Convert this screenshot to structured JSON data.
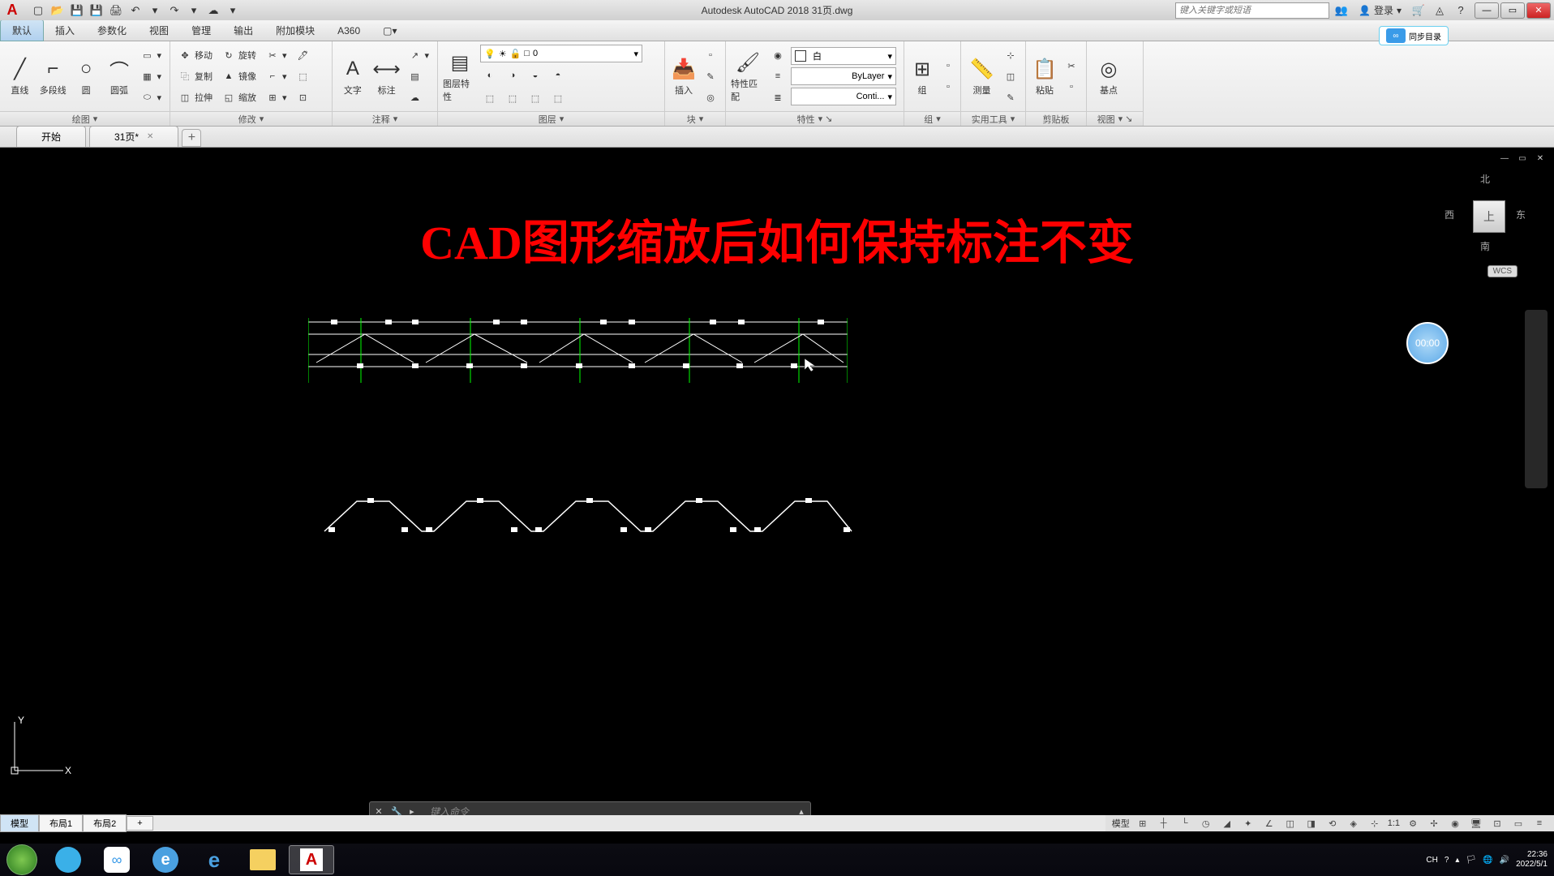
{
  "titlebar": {
    "app_title": "Autodesk AutoCAD 2018    31页.dwg",
    "search_placeholder": "键入关键字或短语",
    "login_label": "登录"
  },
  "menubar": {
    "items": [
      "默认",
      "插入",
      "参数化",
      "视图",
      "管理",
      "输出",
      "附加模块",
      "A360"
    ],
    "active_index": 0
  },
  "cloud": {
    "label": "同步目录"
  },
  "ribbon": {
    "panels": [
      {
        "title": "绘图",
        "draw": {
          "line": "直线",
          "polyline": "多段线",
          "circle": "圆",
          "arc": "圆弧"
        }
      },
      {
        "title": "修改",
        "modify": {
          "move": "移动",
          "rotate": "旋转",
          "copy": "复制",
          "mirror": "镜像",
          "stretch": "拉伸",
          "scale": "缩放"
        }
      },
      {
        "title": "注释",
        "annotate": {
          "text": "文字",
          "dim": "标注"
        }
      },
      {
        "title": "图层",
        "layers": {
          "props": "图层特性",
          "current": "0"
        }
      },
      {
        "title": "块",
        "blocks": {
          "insert": "插入"
        }
      },
      {
        "title": "特性",
        "props": {
          "match": "特性匹配",
          "color": "白",
          "layer_line": "ByLayer",
          "ltype": "Conti..."
        }
      },
      {
        "title": "组",
        "groups": {
          "group": "组"
        }
      },
      {
        "title": "实用工具",
        "util": {
          "measure": "测量"
        }
      },
      {
        "title": "剪贴板",
        "clip": {
          "paste": "粘贴"
        }
      },
      {
        "title": "视图",
        "view": {
          "base": "基点"
        }
      }
    ]
  },
  "tabs": {
    "start": "开始",
    "file": "31页*"
  },
  "drawing": {
    "title_text": "CAD图形缩放后如何保持标注不变",
    "timer": "00:00",
    "wcs": "WCS",
    "nav": {
      "n": "北",
      "s": "南",
      "e": "东",
      "w": "西",
      "top": "上"
    }
  },
  "cmdline": {
    "placeholder": "键入命令"
  },
  "model_tabs": {
    "model": "模型",
    "layout1": "布局1",
    "layout2": "布局2"
  },
  "statusbar": {
    "model": "模型",
    "scale": "1:1"
  },
  "taskbar": {
    "ime": "CH",
    "time": "22:36",
    "date": "2022/5/1"
  }
}
